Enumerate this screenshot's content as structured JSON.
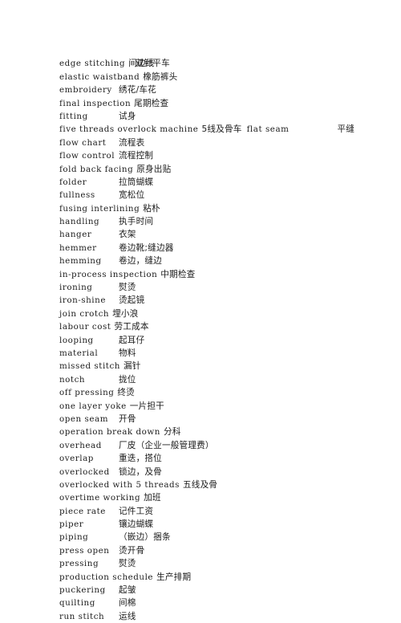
{
  "document": {
    "type": "bilingual-glossary",
    "subject": "garment manufacturing terminology",
    "first_line_chinese": "双针平车",
    "entries": [
      {
        "term": "edge stitching",
        "cn": "间边线",
        "wide": true
      },
      {
        "term": "elastic waistband",
        "cn": "橡筋裤头",
        "wide": true
      },
      {
        "term": "embroidery",
        "cn": "绣花/车花",
        "wide": false
      },
      {
        "term": "final inspection",
        "cn": "尾期检查",
        "wide": true
      },
      {
        "term": "fitting",
        "cn": "试身",
        "wide": false
      },
      {
        "term": "five threads overlock machine",
        "cn": "5线及骨车",
        "wide": true,
        "term2": "flat seam",
        "cn2": "平缝"
      },
      {
        "term": "flow chart",
        "cn": "流程表",
        "wide": false
      },
      {
        "term": "flow control",
        "cn": "流程控制",
        "wide": false
      },
      {
        "term": "fold back facing",
        "cn": "原身出贴",
        "wide": true
      },
      {
        "term": "folder",
        "cn": "拉筒蝴蝶",
        "wide": false
      },
      {
        "term": "fullness",
        "cn": "宽松位",
        "wide": false
      },
      {
        "term": "fusing interlining",
        "cn": "粘朴",
        "wide": true
      },
      {
        "term": "handling",
        "cn": "执手时间",
        "wide": false
      },
      {
        "term": "hanger",
        "cn": "衣架",
        "wide": false
      },
      {
        "term": "hemmer",
        "cn": "卷边靴;缝边器",
        "wide": false
      },
      {
        "term": "hemming",
        "cn": "卷边，缝边",
        "wide": false
      },
      {
        "term": "in-process inspection",
        "cn": "中期检查",
        "wide": true
      },
      {
        "term": "ironing",
        "cn": "熨烫",
        "wide": false
      },
      {
        "term": "iron-shine",
        "cn": "烫起镜",
        "wide": false
      },
      {
        "term": "join crotch",
        "cn": "埋小浪",
        "wide": true
      },
      {
        "term": "labour cost",
        "cn": "劳工成本",
        "wide": true
      },
      {
        "term": "looping",
        "cn": "起耳仔",
        "wide": false
      },
      {
        "term": "material",
        "cn": "物料",
        "wide": false
      },
      {
        "term": "missed stitch",
        "cn": "漏针",
        "wide": true
      },
      {
        "term": "notch",
        "cn": "拢位",
        "wide": false
      },
      {
        "term": "off pressing",
        "cn": "终烫",
        "wide": true
      },
      {
        "term": "one layer yoke",
        "cn": "一片担干",
        "wide": true
      },
      {
        "term": "open seam",
        "cn": "开骨",
        "wide": false
      },
      {
        "term": "operation break down",
        "cn": "分科",
        "wide": true
      },
      {
        "term": "overhead",
        "cn": "厂皮（企业一般管理费）",
        "wide": false
      },
      {
        "term": "overlap",
        "cn": "重迭，搭位",
        "wide": false
      },
      {
        "term": "overlocked",
        "cn": "锁边，及骨",
        "wide": false
      },
      {
        "term": "overlocked with 5 threads",
        "cn": "五线及骨",
        "wide": true
      },
      {
        "term": "overtime working",
        "cn": "加班",
        "wide": true
      },
      {
        "term": "piece rate",
        "cn": "记件工资",
        "wide": false
      },
      {
        "term": "piper",
        "cn": "镶边蝴蝶",
        "wide": false
      },
      {
        "term": "piping",
        "cn": "（嵌边）捆条",
        "wide": false
      },
      {
        "term": "press open",
        "cn": "烫开骨",
        "wide": false
      },
      {
        "term": "pressing",
        "cn": "熨烫",
        "wide": false
      },
      {
        "term": "production schedule",
        "cn": "生产排期",
        "wide": true
      },
      {
        "term": "puckering",
        "cn": "起皱",
        "wide": false
      },
      {
        "term": "quilting",
        "cn": "间棉",
        "wide": false
      },
      {
        "term": "run stitch",
        "cn": "运线",
        "wide": false
      }
    ]
  }
}
